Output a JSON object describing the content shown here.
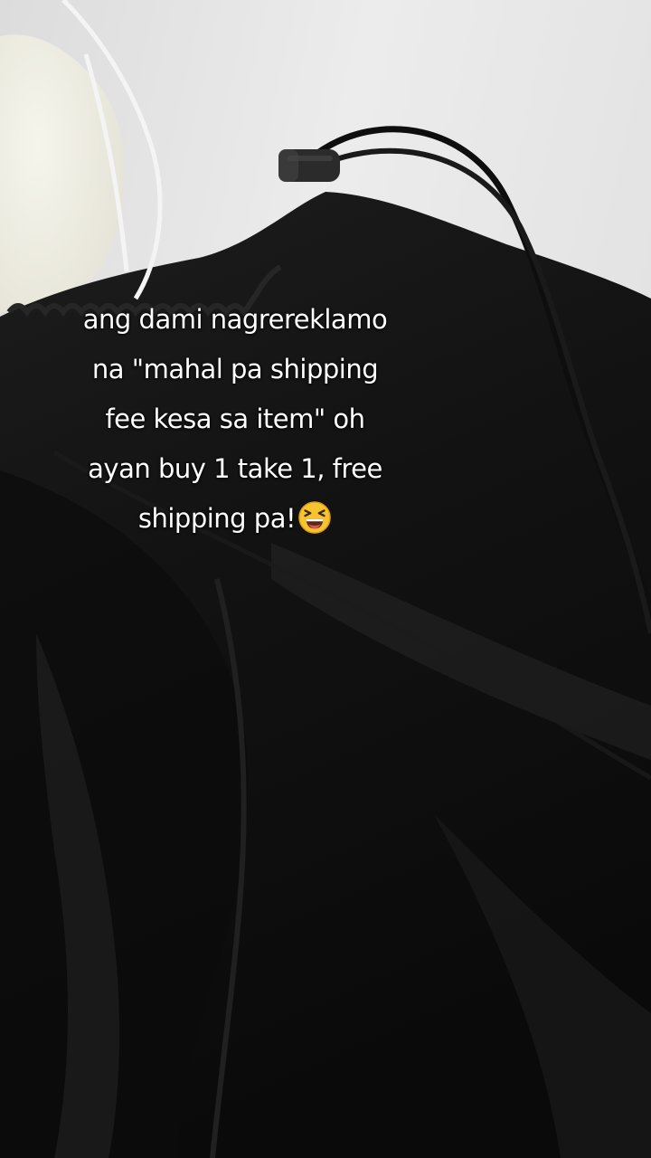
{
  "caption": {
    "lines": [
      "ang dami nagrereklamo",
      "na \"mahal pa shipping",
      "fee kesa sa item\" oh",
      "ayan buy 1 take 1, free",
      "shipping pa!"
    ],
    "emoji": "laughing-squinting-face-icon"
  },
  "colors": {
    "background_surface": "#e9e9ea",
    "garment": "#151515",
    "white_fabric": "#efeee6",
    "caption_text": "#ffffff",
    "emoji_face": "#f7c32e"
  }
}
